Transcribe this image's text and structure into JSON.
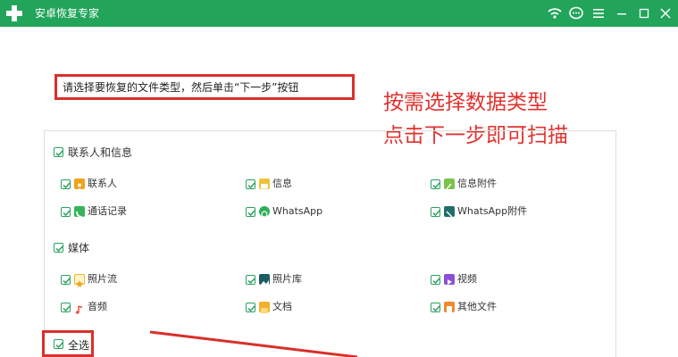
{
  "titlebar": {
    "title": "安卓恢复专家",
    "bg_color": "#22a45a",
    "icons": [
      "wifi-icon",
      "chat-icon",
      "menu-icon",
      "minimize-icon",
      "close-icon"
    ]
  },
  "instruction": "请选择要恢复的文件类型，然后单击“下一步”按钮",
  "annotation": {
    "line1": "按需选择数据类型",
    "line2": "点击下一步即可扫描",
    "color": "#e0322e"
  },
  "groups": {
    "contacts": {
      "label": "联系人和信息",
      "items": [
        {
          "label": "联系人",
          "icon": "contacts-icon"
        },
        {
          "label": "信息",
          "icon": "messages-icon"
        },
        {
          "label": "信息附件",
          "icon": "message-attachment-icon"
        },
        {
          "label": "通话记录",
          "icon": "call-log-icon"
        },
        {
          "label": "WhatsApp",
          "icon": "whatsapp-icon"
        },
        {
          "label": "WhatsApp附件",
          "icon": "whatsapp-attachment-icon"
        }
      ]
    },
    "media": {
      "label": "媒体",
      "items": [
        {
          "label": "照片流",
          "icon": "photo-stream-icon"
        },
        {
          "label": "照片库",
          "icon": "photo-library-icon"
        },
        {
          "label": "视频",
          "icon": "video-icon"
        },
        {
          "label": "音频",
          "icon": "audio-icon"
        },
        {
          "label": "文档",
          "icon": "document-icon"
        },
        {
          "label": "其他文件",
          "icon": "other-files-icon"
        }
      ]
    }
  },
  "select_all": "全选"
}
